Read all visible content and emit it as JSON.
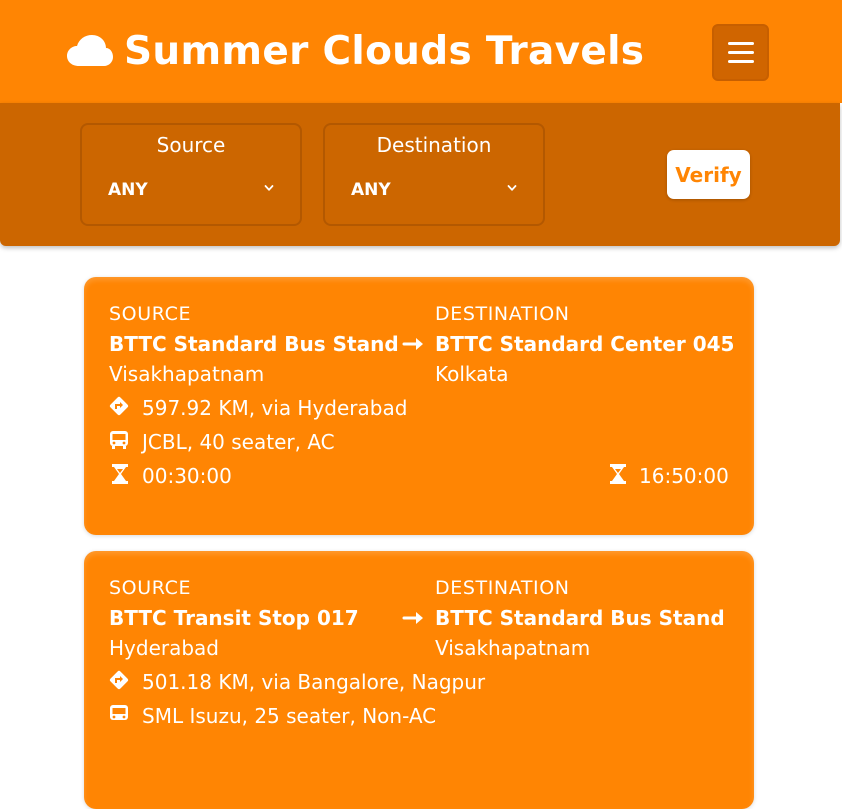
{
  "header": {
    "title": "Summer Clouds Travels",
    "logo_icon": "cloud-icon",
    "menu_icon": "hamburger-icon"
  },
  "filters": {
    "source": {
      "label": "Source",
      "value": "ANY"
    },
    "destination": {
      "label": "Destination",
      "value": "ANY"
    },
    "verify_label": "Verify"
  },
  "trips": [
    {
      "source_caption": "SOURCE",
      "source_name": "BTTC Standard Bus Stand",
      "source_city": "Visakhapatnam",
      "destination_caption": "DESTINATION",
      "destination_name": "BTTC Standard Center 045",
      "destination_city": "Kolkata",
      "route": "597.92 KM, via Hyderabad",
      "bus": "JCBL, 40 seater, AC",
      "departure": "00:30:00",
      "arrival": "16:50:00"
    },
    {
      "source_caption": "SOURCE",
      "source_name": "BTTC Transit Stop 017",
      "source_city": "Hyderabad",
      "destination_caption": "DESTINATION",
      "destination_name": "BTTC Standard Bus Stand",
      "destination_city": "Visakhapatnam",
      "route": "501.18 KM, via Bangalore, Nagpur",
      "bus": "SML Isuzu, 25 seater, Non-AC"
    }
  ],
  "colors": {
    "primary": "#ff8503",
    "primary_dark": "#cc6600",
    "text": "#ffffff"
  }
}
